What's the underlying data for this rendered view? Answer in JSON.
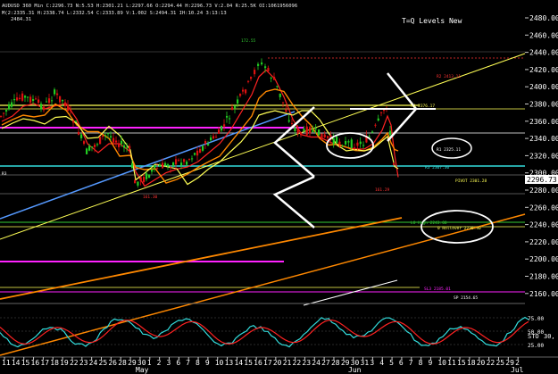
{
  "header": {
    "line1": "AUDUSD 360 Min  C:2296.73  N:5.53  H:2301.21  L:2297.66  O:2294.44  H:2296.73  V:2.04  R:25.5K  OI:1061956096",
    "line2": "M(2:2335.31  H:2338.74  L:2332.54  C:2333.89  V:1.002  S:2494.31  IH:10.24  3:13:13",
    "line3": "2484.31",
    "title": "T=Q Levels New"
  },
  "price_axis": {
    "ticks": [
      "2480.00",
      "2460.00",
      "2440.00",
      "2420.00",
      "2400.00",
      "2380.00",
      "2360.00",
      "2340.00",
      "2320.00",
      "2300.00",
      "2280.00",
      "2260.00",
      "2240.00",
      "2220.00",
      "2200.00",
      "2180.00",
      "2160.00"
    ],
    "last_price": "2296.73"
  },
  "annotations": {
    "peak": "172.55",
    "r2": "R2 2413.11",
    "r4": "R4 2376.17",
    "r1": "R1 2325.11",
    "r3": "R3 2307.30",
    "pivot": "PIVOT 2301.28",
    "low_marker": "161.29",
    "may_low": "161.30",
    "lo_high": "LO High 2243.00",
    "rollover": "0 Rollover 2236.90",
    "s3": "SL3 2185.01",
    "s4": "SP 2154.65",
    "left_marker": "R3"
  },
  "stochastic": {
    "label": "STO",
    "value": "30,",
    "ticks": [
      "75.00",
      "50.00",
      "25.00"
    ]
  },
  "time_axis": {
    "days": [
      "11",
      "14",
      "15",
      "16",
      "17",
      "18",
      "19",
      "22",
      "23",
      "24",
      "25",
      "26",
      "28",
      "29",
      "30",
      "1",
      "2",
      "3",
      "6",
      "7",
      "8",
      "9",
      "10",
      "13",
      "14",
      "15",
      "16",
      "17",
      "20",
      "21",
      "22",
      "23",
      "24",
      "27",
      "28",
      "29",
      "30",
      "31",
      "3",
      "4",
      "5",
      "6",
      "7",
      "8",
      "9",
      "10",
      "11",
      "15",
      "18",
      "20",
      "22",
      "25",
      "29",
      "2"
    ],
    "months": [
      "May",
      "Jun",
      "Jul"
    ]
  },
  "colors": {
    "background": "#000000",
    "up_candle": "#22cc22",
    "down_candle": "#dd1111",
    "yellow": "#ffff55",
    "magenta": "#ff22ff",
    "cyan": "#33dddd",
    "orange": "#ff8800",
    "white": "#ffffff",
    "red_line": "#ff2222",
    "blue_ma": "#5599ff"
  }
}
